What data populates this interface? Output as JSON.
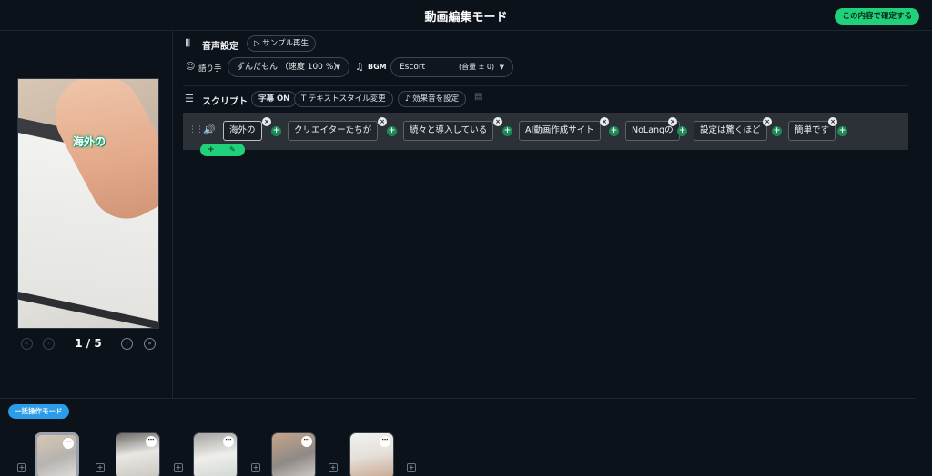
{
  "header": {
    "title": "動画編集モード",
    "confirm_label": "この内容で確定する"
  },
  "audio": {
    "section_label": "音声設定",
    "sample_label": "サンプル再生",
    "narrator_label": "語り手",
    "narrator_value": "ずんだもん （速度 100 %）",
    "bgm_label": "BGM",
    "bgm_value": "Escort",
    "bgm_volume": "(音量 ± 0)"
  },
  "script": {
    "section_label": "スクリプト",
    "subtitle_label": "字幕 ON",
    "text_style_label": "テキストスタイル変更",
    "sound_effect_label": "効果音を設定",
    "chunks": [
      "海外の",
      "クリエイターたちが",
      "続々と導入している",
      "AI動画作成サイト",
      "NoLangの",
      "設定は驚くほど",
      "簡単です"
    ]
  },
  "preview": {
    "caption": "海外の"
  },
  "pager": {
    "current": 1,
    "total": 5,
    "label": "1 / 5"
  },
  "batch_mode_label": "一括操作モード",
  "colors": {
    "accent": "#21d07a",
    "batch": "#2a9ce8",
    "background": "#0c1219"
  }
}
